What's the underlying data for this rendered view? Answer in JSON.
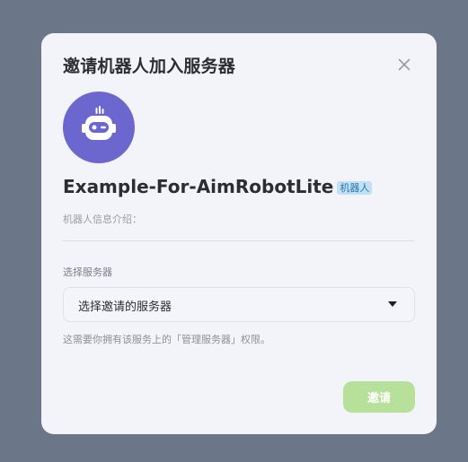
{
  "dialog": {
    "title": "邀请机器人加入服务器",
    "close_icon": "close-icon"
  },
  "bot": {
    "avatar_icon": "robot-icon",
    "avatar_color": "#6c66cf",
    "name": "Example-For-AimRobotLite",
    "tag": "机器人",
    "info_label": "机器人信息介绍："
  },
  "server_select": {
    "label": "选择服务器",
    "value": "选择邀请的服务器",
    "caret_icon": "caret-down-icon"
  },
  "hint": "这需要你拥有该服务上的「管理服务器」权限。",
  "actions": {
    "invite_label": "邀请",
    "invite_color": "#b7e19a"
  }
}
